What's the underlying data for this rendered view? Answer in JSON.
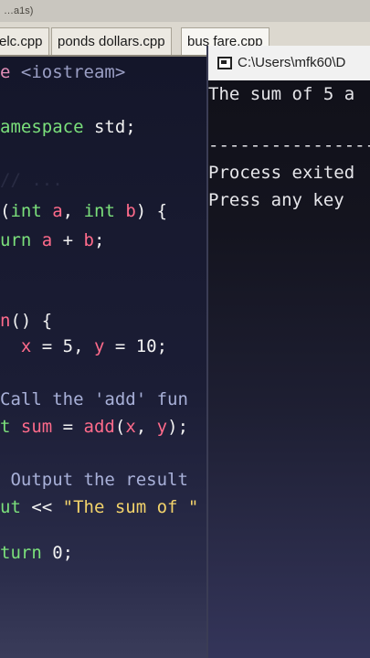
{
  "window": {
    "title_fragment": "…a1s)"
  },
  "tabs": [
    {
      "label": "elc.cpp"
    },
    {
      "label": "ponds dollars.cpp"
    },
    {
      "label": "bus fare.cpp"
    }
  ],
  "editor": {
    "lines": [
      {
        "id": "l1",
        "parts": [
          [
            "pp",
            "e "
          ],
          [
            "inc",
            "<iostream>"
          ]
        ]
      },
      {
        "id": "l2",
        "parts": [
          [
            "kw",
            "amespace"
          ],
          [
            "num",
            " std;"
          ]
        ]
      },
      {
        "id": "l3",
        "parts": [
          [
            "cmt",
            "// ..."
          ]
        ]
      },
      {
        "id": "l4",
        "parts": [
          [
            "num",
            "("
          ],
          [
            "kw",
            "int"
          ],
          [
            "var",
            " a"
          ],
          [
            "num",
            ", "
          ],
          [
            "kw",
            "int"
          ],
          [
            "var",
            " b"
          ],
          [
            "num",
            ") {"
          ]
        ]
      },
      {
        "id": "l5",
        "parts": [
          [
            "kw",
            "urn"
          ],
          [
            "var",
            " a"
          ],
          [
            "num",
            " + "
          ],
          [
            "var",
            "b"
          ],
          [
            "num",
            ";"
          ]
        ]
      },
      {
        "id": "l6",
        "parts": [
          [
            "fn",
            "n"
          ],
          [
            "num",
            "() {"
          ]
        ]
      },
      {
        "id": "l7",
        "parts": [
          [
            "var",
            "  x"
          ],
          [
            "num",
            " = 5, "
          ],
          [
            "var",
            "y"
          ],
          [
            "num",
            " = 10;"
          ]
        ]
      },
      {
        "id": "l8",
        "parts": [
          [
            "cmt",
            "Call the 'add' fun"
          ]
        ]
      },
      {
        "id": "l9",
        "parts": [
          [
            "kw",
            "t"
          ],
          [
            "var",
            " sum"
          ],
          [
            "num",
            " = "
          ],
          [
            "fn",
            "add"
          ],
          [
            "num",
            "("
          ],
          [
            "var",
            "x"
          ],
          [
            "num",
            ", "
          ],
          [
            "var",
            "y"
          ],
          [
            "num",
            ");"
          ]
        ]
      },
      {
        "id": "l10",
        "parts": [
          [
            "cmt",
            " Output the result"
          ]
        ]
      },
      {
        "id": "l11",
        "parts": [
          [
            "kw",
            "ut"
          ],
          [
            "num",
            " << "
          ],
          [
            "str",
            "\"The sum of \""
          ]
        ]
      },
      {
        "id": "l12",
        "parts": [
          [
            "kw",
            "turn"
          ],
          [
            "num",
            " 0;"
          ]
        ]
      }
    ]
  },
  "console": {
    "title": "C:\\Users\\mfk60\\D",
    "output": "The sum of 5 a",
    "separator": "----------------",
    "process_line": "Process exited",
    "press_line": "Press any key"
  }
}
